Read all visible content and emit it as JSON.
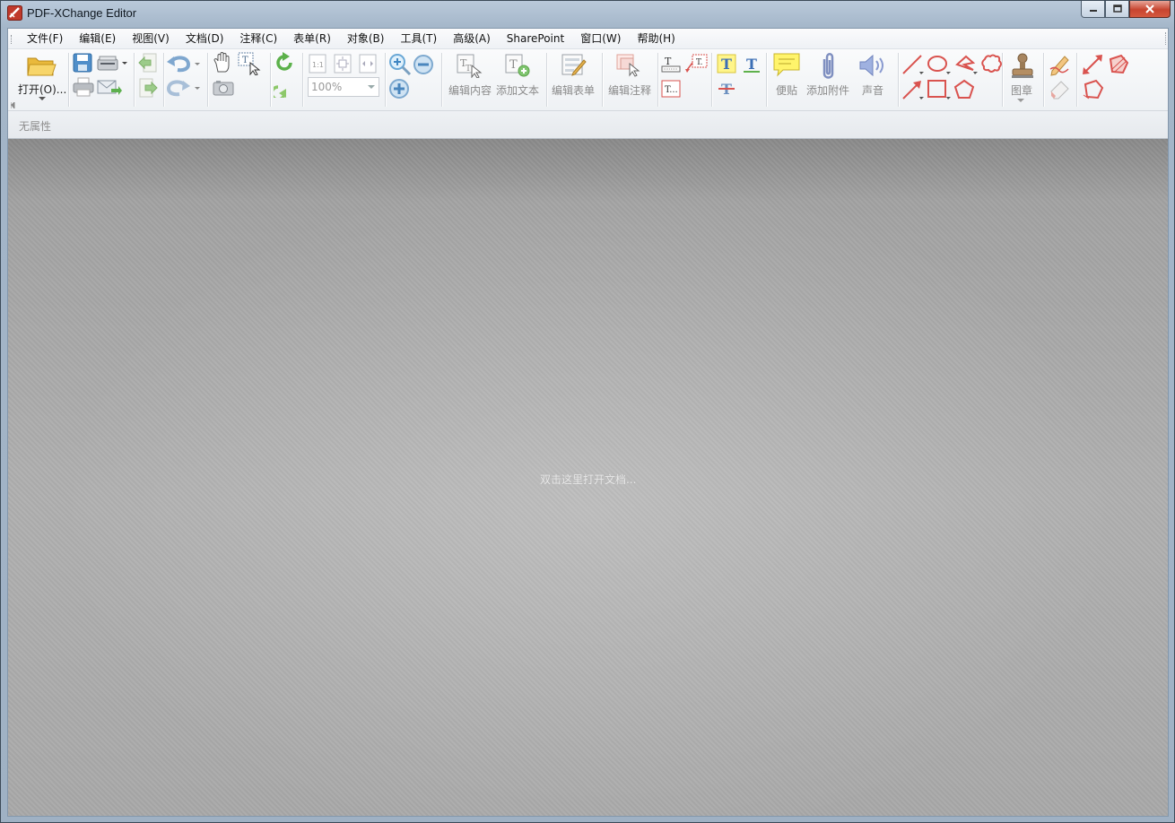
{
  "window": {
    "title": "PDF-XChange Editor",
    "accent_color": "#c0392b"
  },
  "menu": [
    {
      "label": "文件(F)"
    },
    {
      "label": "编辑(E)"
    },
    {
      "label": "视图(V)"
    },
    {
      "label": "文档(D)"
    },
    {
      "label": "注释(C)"
    },
    {
      "label": "表单(R)"
    },
    {
      "label": "对象(B)"
    },
    {
      "label": "工具(T)"
    },
    {
      "label": "高级(A)"
    },
    {
      "label": "SharePoint"
    },
    {
      "label": "窗口(W)"
    },
    {
      "label": "帮助(H)"
    }
  ],
  "toolbar": {
    "open_label": "打开(O)...",
    "zoom_value": "100%",
    "edit_content_label": "编辑内容",
    "add_text_label": "添加文本",
    "edit_form_label": "编辑表单",
    "edit_annotation_label": "编辑注释",
    "sticky_note_label": "便贴",
    "attach_file_label": "添加附件",
    "sound_label": "声音",
    "stamp_label": "图章"
  },
  "properties_bar": {
    "text": "无属性"
  },
  "document_area": {
    "hint": "双击这里打开文档..."
  }
}
